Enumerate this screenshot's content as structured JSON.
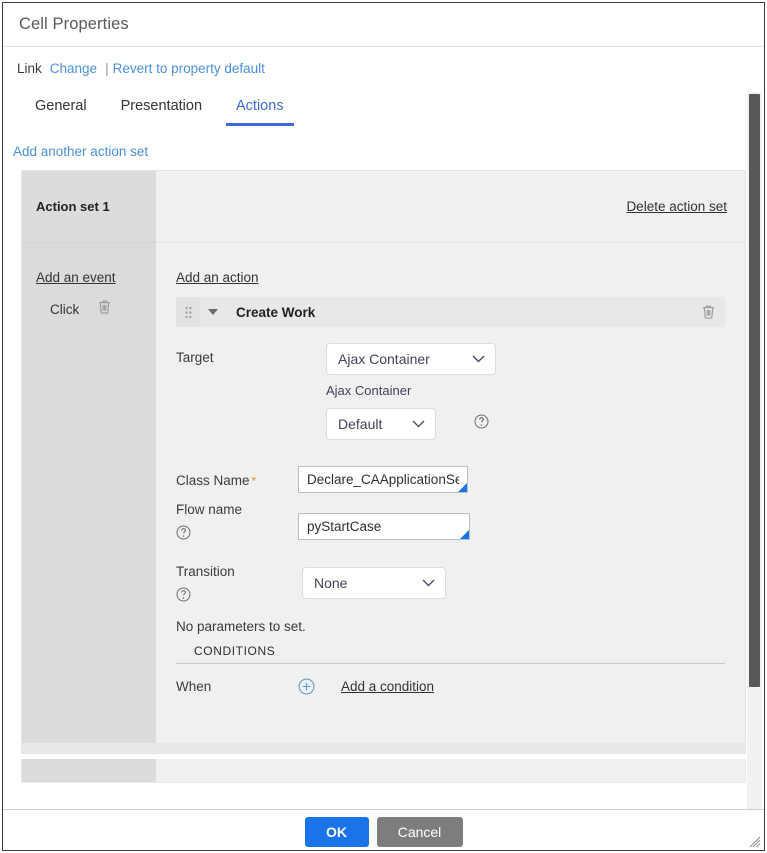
{
  "window": {
    "title": "Cell Properties"
  },
  "link_row": {
    "label": "Link",
    "change_label": "Change",
    "separator": "|",
    "revert_label": "Revert to property default"
  },
  "tabs": [
    {
      "label": "General",
      "active": false
    },
    {
      "label": "Presentation",
      "active": false
    },
    {
      "label": "Actions",
      "active": true
    }
  ],
  "add_action_set_label": "Add another action set",
  "action_set": {
    "title": "Action set 1",
    "delete_label": "Delete action set",
    "events": {
      "add_label": "Add an event",
      "items": [
        {
          "name": "Click",
          "delete_icon": "trash-icon"
        }
      ]
    },
    "actions": {
      "add_label": "Add an action",
      "header": {
        "drag_icon": "drag-handle-icon",
        "collapse_icon": "caret-down-icon",
        "title": "Create Work",
        "delete_icon": "trash-icon"
      },
      "fields": {
        "target_label": "Target",
        "target_value": "Ajax Container",
        "target_options": [
          "Ajax Container"
        ],
        "ajax_container_label": "Ajax Container",
        "ajax_container_value": "Default",
        "ajax_container_options": [
          "Default"
        ],
        "ajax_help_icon": "help-circle-icon",
        "class_name_label": "Class Name",
        "class_name_required": "*",
        "class_name_value": "Declare_CAApplicationSett",
        "flow_name_label": "Flow name",
        "flow_name_help_icon": "help-circle-icon",
        "flow_name_value": "pyStartCase",
        "transition_label": "Transition",
        "transition_help_icon": "help-circle-icon",
        "transition_value": "None",
        "transition_options": [
          "None"
        ],
        "no_params_text": "No parameters to set."
      },
      "conditions": {
        "heading": "CONDITIONS",
        "when_label": "When",
        "add_icon": "plus-circle-icon",
        "add_label": "Add a condition"
      }
    }
  },
  "scrollbar": {
    "name": "vertical-scrollbar"
  },
  "footer": {
    "ok_label": "OK",
    "cancel_label": "Cancel"
  },
  "colors": {
    "accent_blue": "#1a73e8",
    "link_blue": "#4a90d9",
    "tab_active": "#3f6ad8",
    "required_star": "#e8912a",
    "cancel_gray": "#7d7d7d",
    "panel_gray": "#f0f0f0",
    "left_col_gray": "#dcdcdc"
  }
}
